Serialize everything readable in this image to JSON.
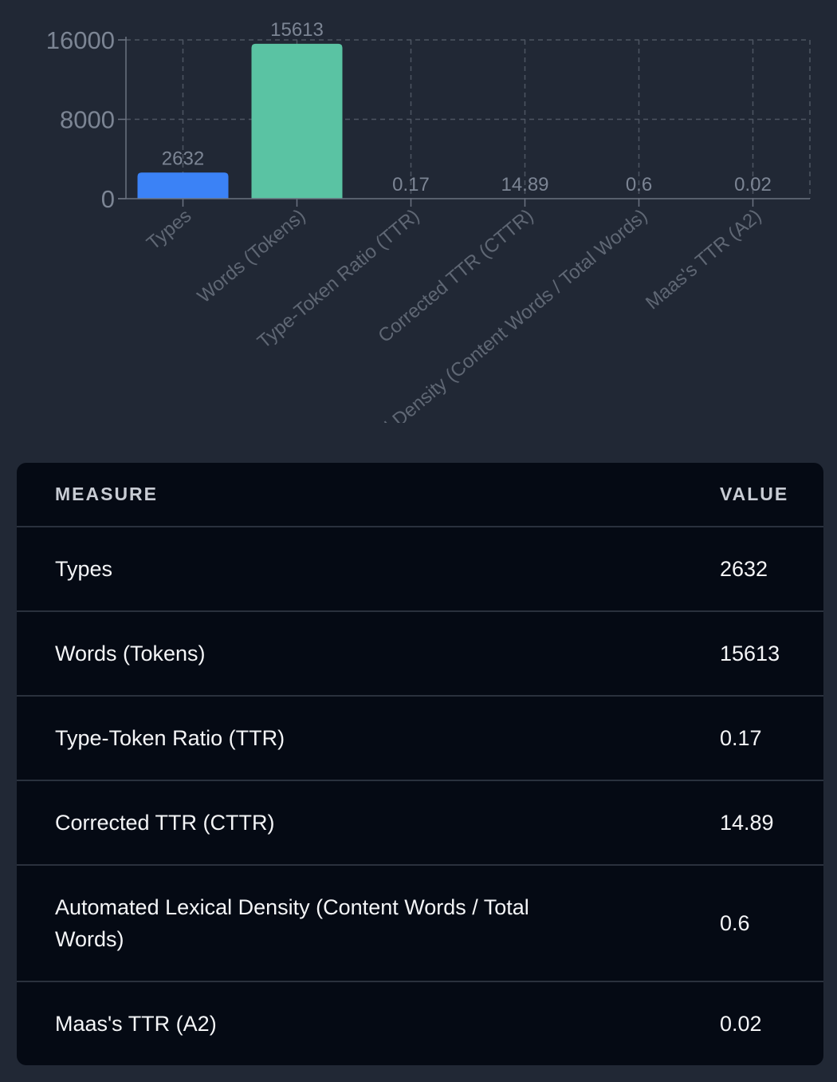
{
  "chart_data": {
    "type": "bar",
    "categories": [
      "Types",
      "Words (Tokens)",
      "Type-Token Ratio (TTR)",
      "Corrected TTR (CTTR)",
      "Automated Lexical Density (Content Words / Total Words)",
      "Maas's TTR (A2)"
    ],
    "values": [
      2632,
      15613,
      0.17,
      14.89,
      0.6,
      0.02
    ],
    "data_labels": [
      "2632",
      "15613",
      "0.17",
      "14.89",
      "0.6",
      "0.02"
    ],
    "y_ticks": [
      "0",
      "8000",
      "16000"
    ],
    "ylim": [
      0,
      16000
    ],
    "grid": true,
    "bar_colors": [
      "#3b82f6",
      "#5ac3a3",
      "#7c8594",
      "#7c8594",
      "#7c8594",
      "#7c8594"
    ],
    "xlabel": "",
    "ylabel": ""
  },
  "table": {
    "header_measure": "MEASURE",
    "header_value": "VALUE",
    "rows": [
      {
        "measure": "Types",
        "value": "2632"
      },
      {
        "measure": "Words (Tokens)",
        "value": "15613"
      },
      {
        "measure": "Type-Token Ratio (TTR)",
        "value": "0.17"
      },
      {
        "measure": "Corrected TTR (CTTR)",
        "value": "14.89"
      },
      {
        "measure": "Automated Lexical Density (Content Words / Total Words)",
        "value": "0.6"
      },
      {
        "measure": "Maas's TTR (A2)",
        "value": "0.02"
      }
    ]
  }
}
